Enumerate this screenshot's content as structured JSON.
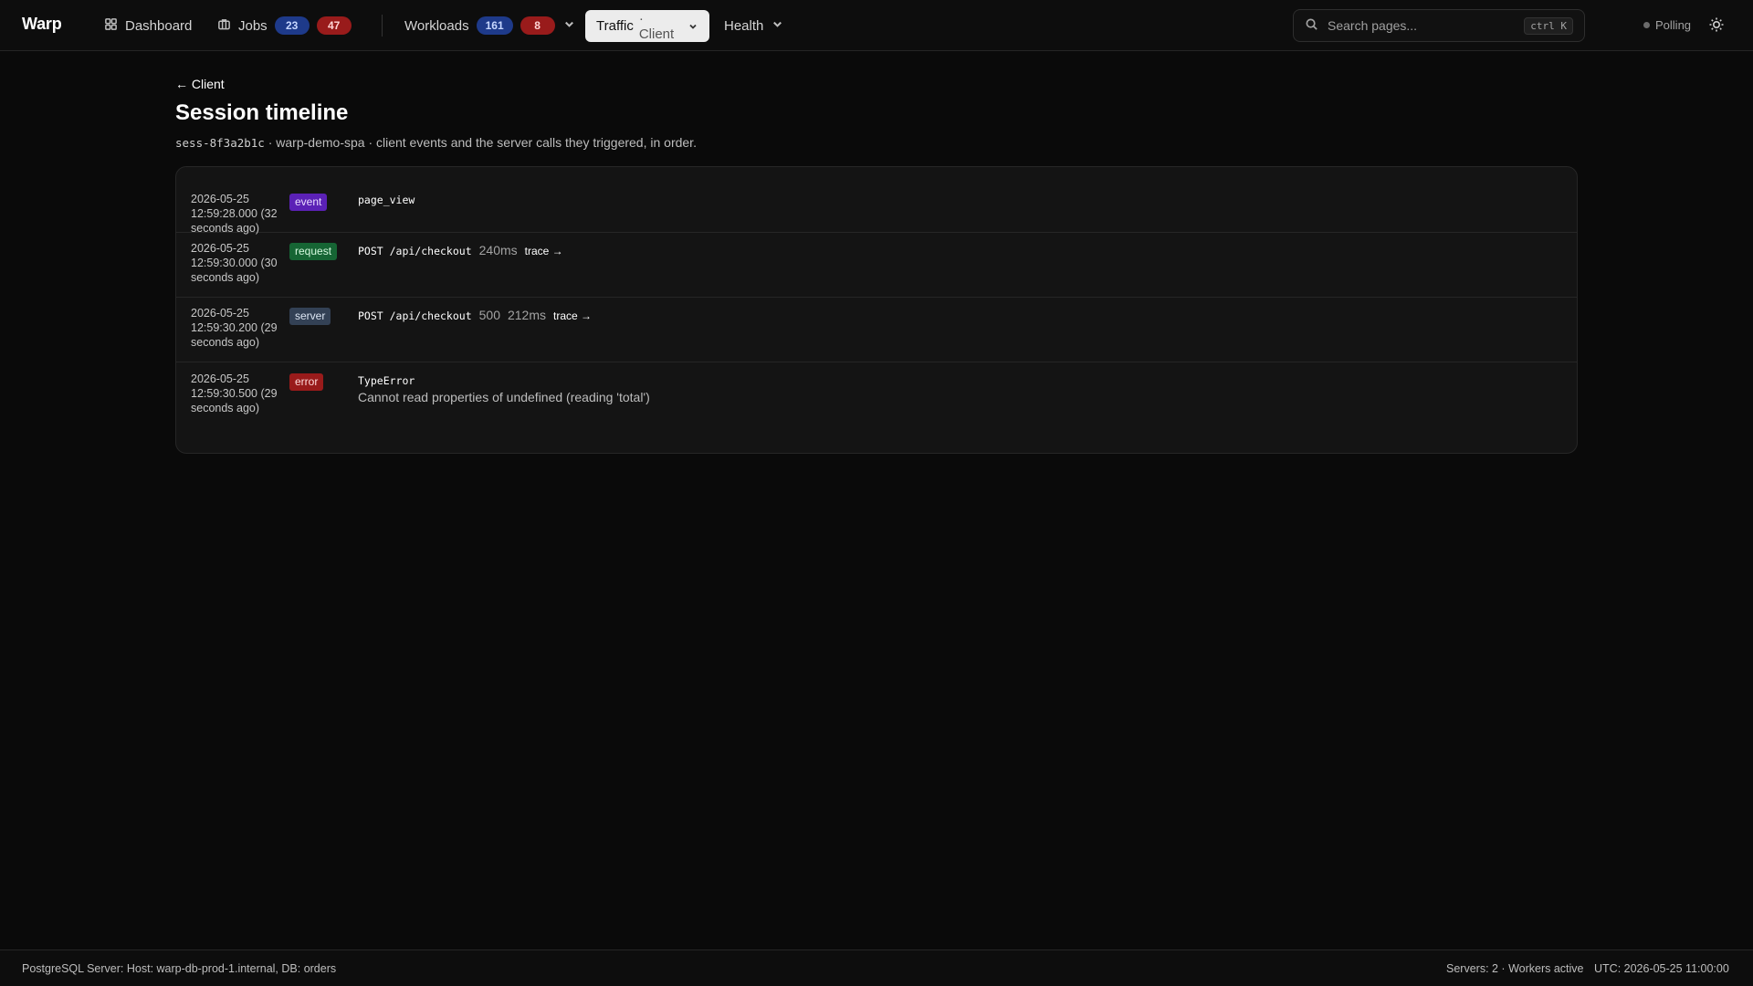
{
  "app": {
    "brand": "Warp"
  },
  "nav": {
    "dashboard": "Dashboard",
    "jobs": {
      "label": "Jobs",
      "count_blue": "23",
      "count_red": "47"
    },
    "workloads": {
      "label": "Workloads",
      "count_blue": "161",
      "count_red": "8"
    },
    "traffic": {
      "label": "Traffic",
      "sub": "· Client"
    },
    "health": "Health"
  },
  "search": {
    "placeholder": "Search pages...",
    "shortcut": "ctrl K"
  },
  "status": {
    "polling": "Polling"
  },
  "page": {
    "back": "← Client",
    "title": "Session timeline",
    "session_id": "sess-8f3a2b1c",
    "subtitle_rest": "· warp-demo-spa · client events and the server calls they triggered, in order."
  },
  "timeline": [
    {
      "date": "2026-05-25",
      "time": "12:59:28.000 (32",
      "ago": "seconds ago)",
      "kind": "event",
      "text": "page_view"
    },
    {
      "date": "2026-05-25",
      "time": "12:59:30.000 (30",
      "ago": "seconds ago)",
      "kind": "request",
      "text": "POST /api/checkout",
      "duration": "240ms",
      "trace": "trace →"
    },
    {
      "date": "2026-05-25",
      "time": "12:59:30.200 (29",
      "ago": "seconds ago)",
      "kind": "server",
      "text": "POST /api/checkout",
      "status": "500",
      "duration": "212ms",
      "trace": "trace →"
    },
    {
      "date": "2026-05-25",
      "time": "12:59:30.500 (29",
      "ago": "seconds ago)",
      "kind": "error",
      "text": "TypeError",
      "message": "Cannot read properties of undefined (reading 'total')"
    }
  ],
  "footer": {
    "db": "PostgreSQL Server: Host: warp-db-prod-1.internal, DB: orders",
    "servers": "Servers: 2 · Workers active",
    "utc": "UTC: 2026-05-25 11:00:00"
  }
}
